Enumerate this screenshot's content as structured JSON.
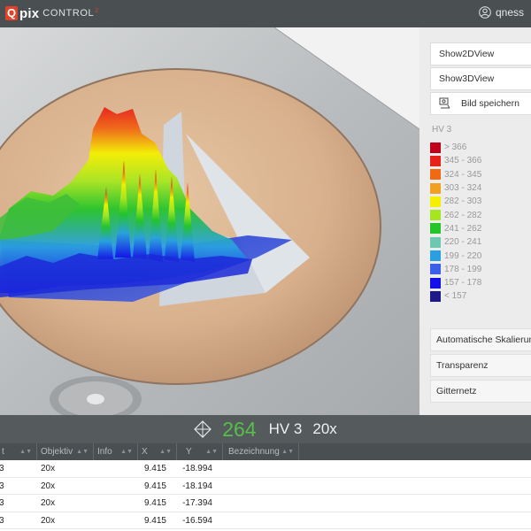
{
  "header": {
    "logo_q": "Q",
    "logo_pix": "pix",
    "logo_control": "CONTROL",
    "logo_small": "2",
    "user_name": "qness"
  },
  "panel": {
    "show2d_label": "Show2DView",
    "show3d_label": "Show3DView",
    "save_label": "Bild speichern",
    "legend_title": "HV 3",
    "legend": [
      {
        "label": "> 366",
        "color": "#c0001a"
      },
      {
        "label": "345 - 366",
        "color": "#e8201a"
      },
      {
        "label": "324 - 345",
        "color": "#f06a14"
      },
      {
        "label": "303 - 324",
        "color": "#f3a020"
      },
      {
        "label": "282 - 303",
        "color": "#f4f000"
      },
      {
        "label": "262 - 282",
        "color": "#a6e620"
      },
      {
        "label": "241 - 262",
        "color": "#24c42a"
      },
      {
        "label": "220 - 241",
        "color": "#6cc8b0"
      },
      {
        "label": "199 - 220",
        "color": "#2aa0e0"
      },
      {
        "label": "178 - 199",
        "color": "#3a60e8"
      },
      {
        "label": "157 - 178",
        "color": "#1410e8"
      },
      {
        "label": "< 157",
        "color": "#1e1a8a"
      }
    ],
    "auto_scale_label": "Automatische Skalierung",
    "transparency_label": "Transparenz",
    "grid_label": "Gitternetz"
  },
  "status": {
    "value": "264",
    "method": "HV 3",
    "objective": "20x"
  },
  "table": {
    "columns": [
      "t",
      "Objektiv",
      "Info",
      "X",
      "Y",
      "Bezeichnung"
    ],
    "rows": [
      {
        "c0": "3",
        "objektiv": "20x",
        "x": "9.415",
        "y": "-18.994"
      },
      {
        "c0": "3",
        "objektiv": "20x",
        "x": "9.415",
        "y": "-18.194"
      },
      {
        "c0": "3",
        "objektiv": "20x",
        "x": "9.415",
        "y": "-17.394"
      },
      {
        "c0": "3",
        "objektiv": "20x",
        "x": "9.415",
        "y": "-16.594"
      }
    ]
  }
}
